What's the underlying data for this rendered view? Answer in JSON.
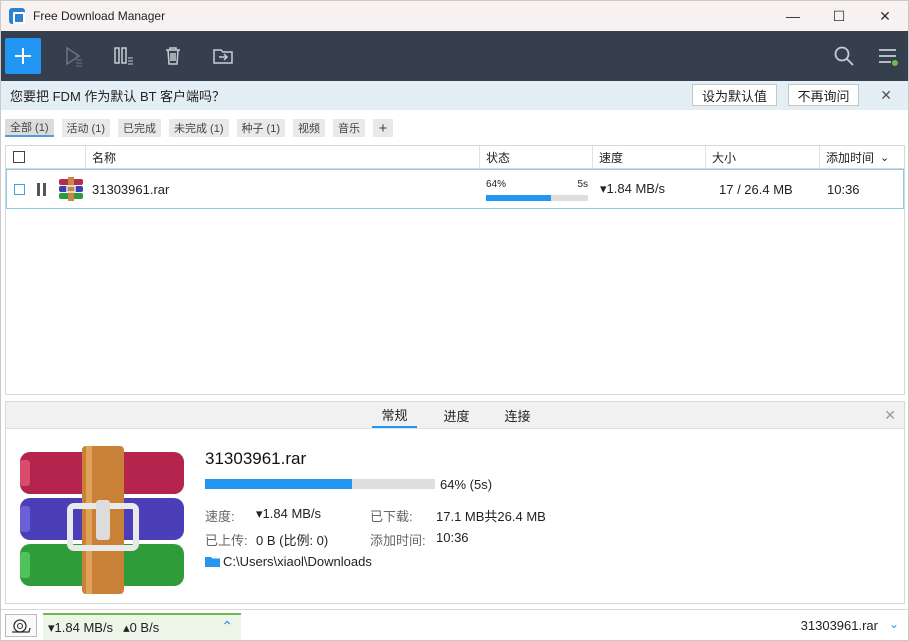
{
  "window": {
    "title": "Free Download Manager",
    "minimize": "—",
    "maximize": "☐",
    "close": "✕"
  },
  "notification": {
    "text": "您要把 FDM 作为默认 BT 客户端吗？",
    "set_default": "设为默认值",
    "dont_ask": "不再询问",
    "close": "✕"
  },
  "filters": [
    {
      "label": "全部 (1)",
      "active": true
    },
    {
      "label": "活动 (1)",
      "active": false
    },
    {
      "label": "已完成",
      "active": false
    },
    {
      "label": "未完成 (1)",
      "active": false
    },
    {
      "label": "种子 (1)",
      "active": false
    },
    {
      "label": "视频",
      "active": false
    },
    {
      "label": "音乐",
      "active": false
    }
  ],
  "filter_add": "+",
  "table": {
    "headers": {
      "name": "名称",
      "status": "状态",
      "speed": "速度",
      "size": "大小",
      "added": "添加时间",
      "sort_indicator": "⌄"
    },
    "rows": [
      {
        "name": "31303961.rar",
        "status_pct": "64%",
        "status_eta": "5s",
        "progress": 0.64,
        "speed": "▾1.84 MB/s",
        "size": "17 / 26.4 MB",
        "added": "10:36"
      }
    ]
  },
  "details": {
    "tabs": [
      "常规",
      "进度",
      "连接"
    ],
    "active_tab": 0,
    "close": "✕",
    "file_name": "31303961.rar",
    "progress": 0.64,
    "progress_text": "64% (5s)",
    "speed_label": "速度:",
    "speed_value": "▾1.84 MB/s",
    "downloaded_label": "已下载:",
    "downloaded_value": "17.1 MB共26.4 MB",
    "uploaded_label": "已上传:",
    "uploaded_value": "0 B (比例: 0)",
    "added_label": "添加时间:",
    "added_value": "10:36",
    "path": "C:\\Users\\xiaol\\Downloads"
  },
  "statusbar": {
    "download_speed": "▾1.84 MB/s",
    "upload_speed": "▴0 B/s",
    "expand": "⌃",
    "current_file": "31303961.rar",
    "chevron": "⌄"
  },
  "colors": {
    "accent": "#2196f3",
    "toolbar_bg": "#353f4d",
    "notify_bg": "#e4eef5",
    "speed_green": "#6dbb4a"
  }
}
